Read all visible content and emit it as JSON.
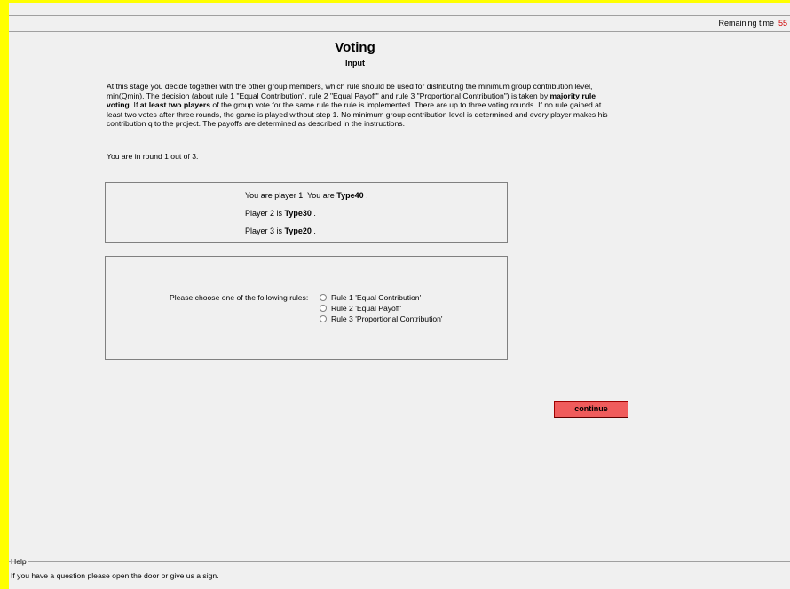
{
  "timer": {
    "label": "Remaining time",
    "value": "55"
  },
  "header": {
    "title": "Voting",
    "subtitle": "Input"
  },
  "instructions": {
    "p1": "At this stage you decide together with the other group members, which rule should be used for distributing the minimum group contribution level, min(Qmin). The decision (about rule 1 \"Equal Contribution\", rule 2 \"Equal Payoff\" and rule 3 \"Proportional Contribution\") is taken by ",
    "b1": "majority rule voting",
    "p2": ". If ",
    "b2": "at least two players",
    "p3": " of the group vote for the same rule the rule is implemented. There are up to three voting rounds. If no rule gained at least two votes after three rounds, the game is played without step 1. No minimum group contribution level is determined and every player makes his contribution q to the project. The payoffs are determined as described in the instructions."
  },
  "round_text": "You are in round 1 out of 3.",
  "players": {
    "p1_prefix": "You are player 1. You are ",
    "p1_type": "Type40",
    "p2_prefix": "Player 2 is ",
    "p2_type": "Type30",
    "p3_prefix": "Player 3 is ",
    "p3_type": "Type20",
    "suffix": " ."
  },
  "rules": {
    "label": "Please choose one of the following rules:",
    "options": [
      "Rule 1 'Equal Contribution'",
      "Rule 2 'Equal Payoff'",
      "Rule 3 'Proportional Contribution'"
    ]
  },
  "continue_label": "continue",
  "help": {
    "title": "Help",
    "text": "If you have a question please open the door or give us a sign."
  }
}
